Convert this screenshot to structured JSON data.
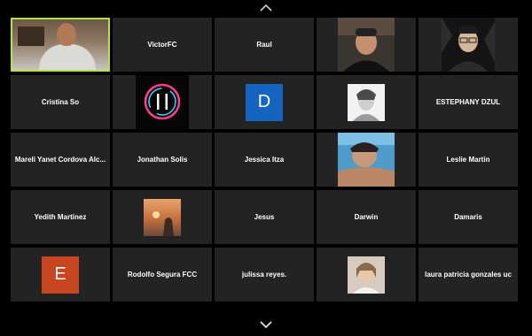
{
  "participants": [
    {
      "type": "video",
      "name": "",
      "active": true
    },
    {
      "type": "name",
      "name": "VictorFC"
    },
    {
      "type": "name",
      "name": "Raul"
    },
    {
      "type": "photo",
      "name": "",
      "thumb": "man-beanie",
      "bg": "#2a2a2a"
    },
    {
      "type": "photo",
      "name": "",
      "thumb": "man-glasses",
      "bg": "#1f1f1f"
    },
    {
      "type": "name",
      "name": "Cristina So"
    },
    {
      "type": "photo",
      "name": "",
      "thumb": "neon-logo",
      "bg": "#0a0a0a"
    },
    {
      "type": "letter",
      "name": "",
      "letter": "D",
      "color": "#1565c0"
    },
    {
      "type": "photo",
      "name": "",
      "thumb": "sketch-portrait",
      "bg": "#e9e9e9"
    },
    {
      "type": "name",
      "name": "ESTEPHANY DZUL"
    },
    {
      "type": "name",
      "name": "Mareli Yanet Cordova Alc..."
    },
    {
      "type": "name",
      "name": "Jonathan Solis"
    },
    {
      "type": "name",
      "name": "Jessica Itza"
    },
    {
      "type": "photo",
      "name": "",
      "thumb": "pool-portrait",
      "bg": "#6aaed6"
    },
    {
      "type": "name",
      "name": "Leslie Martin"
    },
    {
      "type": "name",
      "name": "Yedith Martinez"
    },
    {
      "type": "photo",
      "name": "",
      "thumb": "sunset",
      "bg": "#c97c4a"
    },
    {
      "type": "name",
      "name": "Jesus"
    },
    {
      "type": "name",
      "name": "Darwin"
    },
    {
      "type": "name",
      "name": "Damaris"
    },
    {
      "type": "letter",
      "name": "",
      "letter": "E",
      "color": "#c8451f"
    },
    {
      "type": "name",
      "name": "Rodolfo Segura FCC"
    },
    {
      "type": "name",
      "name": "julissa reyes."
    },
    {
      "type": "photo",
      "name": "",
      "thumb": "girl-portrait",
      "bg": "#d9cfc4"
    },
    {
      "type": "name",
      "name": "laura patricia gonzales uc"
    }
  ],
  "nav": {
    "up_icon": "chevron-up-icon",
    "down_icon": "chevron-down-icon"
  },
  "colors": {
    "tile_bg": "#232323",
    "active_border": "#b9e04a",
    "page_bg": "#000000"
  }
}
